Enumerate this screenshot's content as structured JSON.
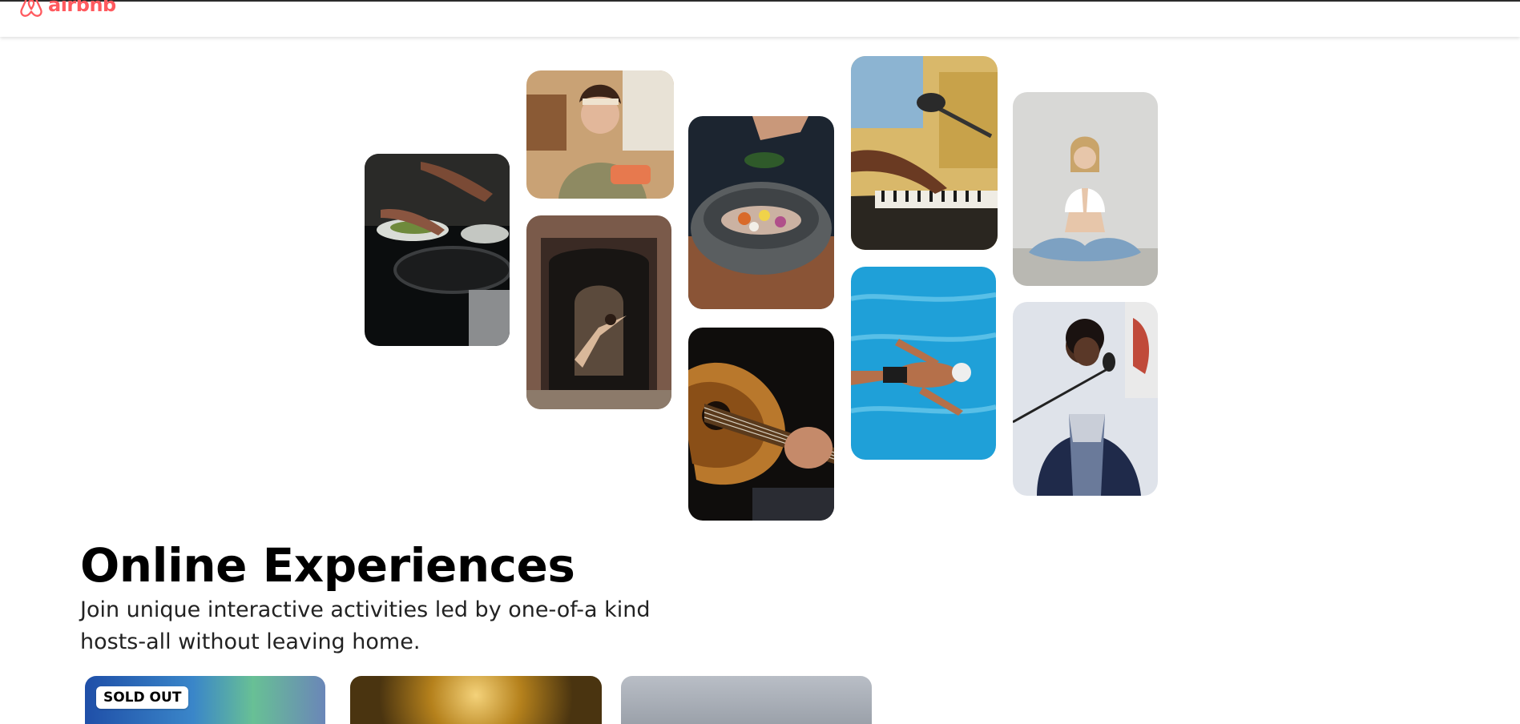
{
  "header": {
    "logo_text": "airbnb",
    "logo_icon": "airbnb-belo-icon",
    "brand_color": "#FF5A5F"
  },
  "gallery": {
    "photos": [
      {
        "name": "cooking-class-photo"
      },
      {
        "name": "chef-host-photo"
      },
      {
        "name": "dancer-photo"
      },
      {
        "name": "salad-bowl-photo"
      },
      {
        "name": "acoustic-guitar-photo"
      },
      {
        "name": "piano-microphone-photo"
      },
      {
        "name": "swimmer-photo"
      },
      {
        "name": "yoga-meditation-photo"
      },
      {
        "name": "singer-photo"
      }
    ]
  },
  "hero": {
    "title": "Online Experiences",
    "subtitle": "Join unique interactive activities led by one-of-a kind hosts-all without leaving home."
  },
  "cards": [
    {
      "badge": "SOLD OUT"
    },
    {
      "badge": ""
    },
    {
      "badge": ""
    }
  ]
}
